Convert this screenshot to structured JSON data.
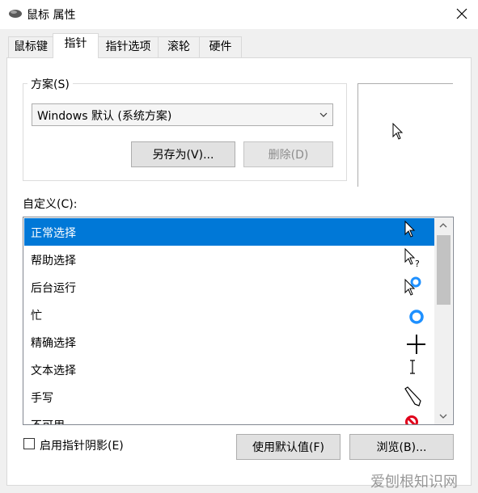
{
  "window": {
    "title": "鼠标 属性"
  },
  "tabs": [
    {
      "label": "鼠标键"
    },
    {
      "label": "指针"
    },
    {
      "label": "指针选项"
    },
    {
      "label": "滚轮"
    },
    {
      "label": "硬件"
    }
  ],
  "scheme": {
    "label": "方案(S)",
    "selected": "Windows 默认 (系统方案)",
    "save_as_button": "另存为(V)...",
    "delete_button": "删除(D)"
  },
  "custom": {
    "label": "自定义(C):",
    "items": [
      {
        "label": "正常选择",
        "icon": "arrow-cursor-icon",
        "selected": true
      },
      {
        "label": "帮助选择",
        "icon": "help-cursor-icon"
      },
      {
        "label": "后台运行",
        "icon": "working-in-background-cursor-icon"
      },
      {
        "label": "忙",
        "icon": "busy-cursor-icon"
      },
      {
        "label": "精确选择",
        "icon": "crosshair-cursor-icon"
      },
      {
        "label": "文本选择",
        "icon": "text-select-cursor-icon"
      },
      {
        "label": "手写",
        "icon": "handwriting-pen-cursor-icon"
      },
      {
        "label": "不可用",
        "icon": "unavailable-cursor-icon"
      }
    ]
  },
  "shadow_checkbox": {
    "label": "启用指针阴影(E)",
    "checked": false
  },
  "buttons": {
    "use_default": "使用默认值(F)",
    "browse": "浏览(B)..."
  },
  "watermark": "爱刨根知识网",
  "colors": {
    "selection": "#0078d7",
    "busy_ring": "#1e90ff",
    "unavailable": "#e0001b"
  }
}
